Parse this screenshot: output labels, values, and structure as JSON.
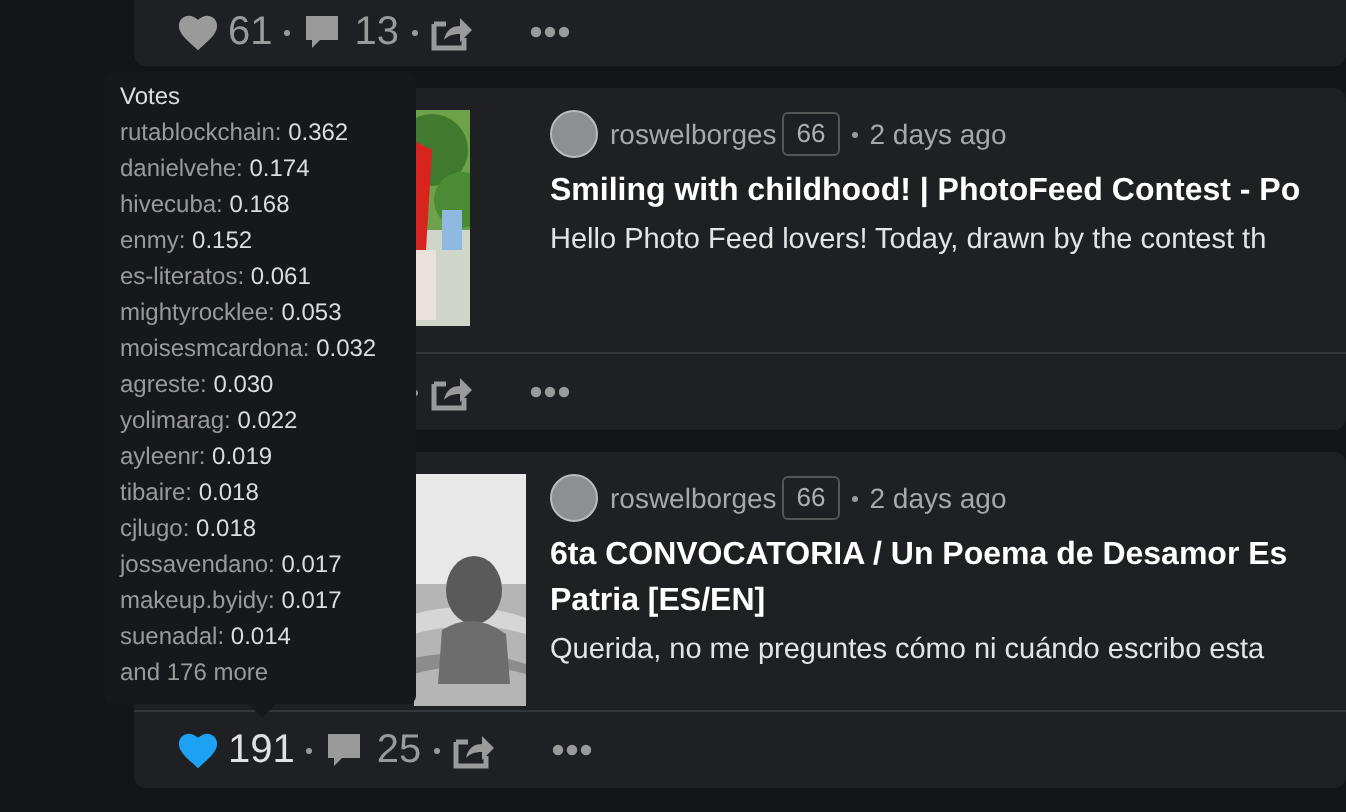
{
  "top_post": {
    "footer": {
      "voted": false,
      "likes": "61",
      "comments": "13"
    }
  },
  "posts": [
    {
      "author": "roswelborges",
      "reputation": "66",
      "time": "2 days ago",
      "title": "Smiling with childhood! | PhotoFeed Contest - Po",
      "excerpt": "Hello Photo Feed lovers! Today, drawn by the contest th"
    },
    {
      "author": "roswelborges",
      "reputation": "66",
      "time": "2 days ago",
      "title": "6ta CONVOCATORIA / Un Poema de Desamor Es\nPatria [ES/EN]",
      "excerpt": "Querida, no me preguntes cómo ni cuándo escribo esta",
      "footer": {
        "voted": true,
        "likes": "191",
        "comments": "25"
      }
    }
  ],
  "tooltip": {
    "title": "Votes",
    "votes": [
      {
        "voter": "rutablockchain:",
        "weight": "0.362"
      },
      {
        "voter": "danielvehe:",
        "weight": "0.174"
      },
      {
        "voter": "hivecuba:",
        "weight": "0.168"
      },
      {
        "voter": "enmy:",
        "weight": "0.152"
      },
      {
        "voter": "es-literatos:",
        "weight": "0.061"
      },
      {
        "voter": "mightyrocklee:",
        "weight": "0.053"
      },
      {
        "voter": "moisesmcardona:",
        "weight": "0.032"
      },
      {
        "voter": "agreste:",
        "weight": "0.030"
      },
      {
        "voter": "yolimarag:",
        "weight": "0.022"
      },
      {
        "voter": "ayleenr:",
        "weight": "0.019"
      },
      {
        "voter": "tibaire:",
        "weight": "0.018"
      },
      {
        "voter": "cjlugo:",
        "weight": "0.018"
      },
      {
        "voter": "jossavendano:",
        "weight": "0.017"
      },
      {
        "voter": "makeup.byidy:",
        "weight": "0.017"
      },
      {
        "voter": "suenadal:",
        "weight": "0.014"
      }
    ],
    "more": "and 176 more"
  }
}
